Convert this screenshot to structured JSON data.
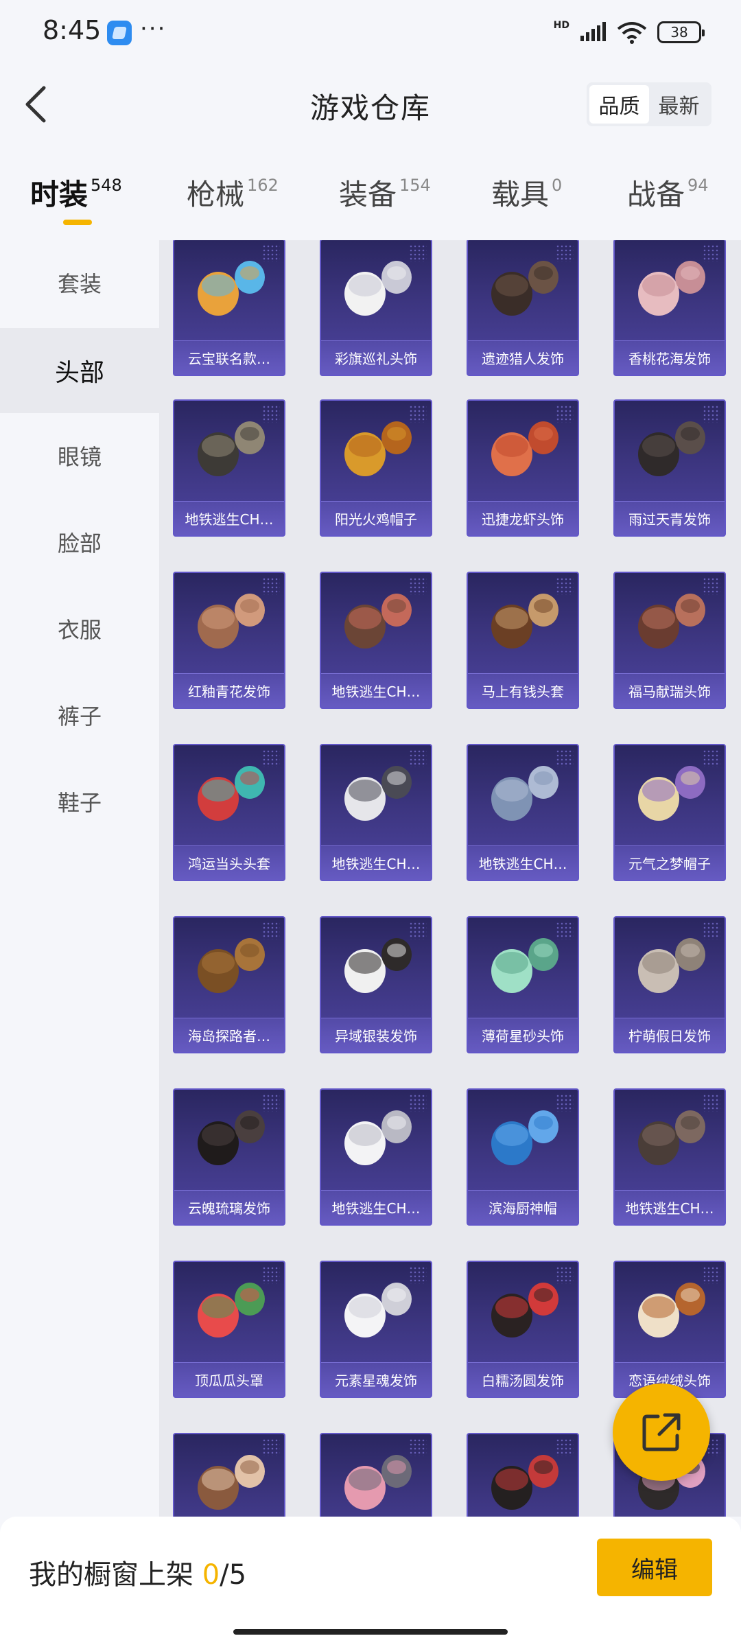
{
  "status_bar": {
    "time": "8:45",
    "more": "···",
    "network": "HD",
    "battery": "38",
    "wifi_sub": "6"
  },
  "header": {
    "title": "游戏仓库",
    "sort_options": [
      "品质",
      "最新"
    ],
    "active_sort": "品质"
  },
  "tabs": [
    {
      "label": "时装",
      "count": "548",
      "active": true
    },
    {
      "label": "枪械",
      "count": "162",
      "active": false
    },
    {
      "label": "装备",
      "count": "154",
      "active": false
    },
    {
      "label": "载具",
      "count": "0",
      "active": false
    },
    {
      "label": "战备",
      "count": "94",
      "active": false
    }
  ],
  "sidebar": {
    "items": [
      "套装",
      "头部",
      "眼镜",
      "脸部",
      "衣服",
      "裤子",
      "鞋子"
    ],
    "active": "头部"
  },
  "items": [
    "云宝联名款…",
    "彩旗巡礼头饰",
    "遗迹猎人发饰",
    "香桃花海发饰",
    "地铁逃生CH…",
    "阳光火鸡帽子",
    "迅捷龙虾头饰",
    "雨过天青发饰",
    "红釉青花发饰",
    "地铁逃生CH…",
    "马上有钱头套",
    "福马献瑞头饰",
    "鸿运当头头套",
    "地铁逃生CH…",
    "地铁逃生CH…",
    "元气之梦帽子",
    "海岛探路者…",
    "异域银装发饰",
    "薄荷星砂头饰",
    "柠萌假日发饰",
    "云魄琉璃发饰",
    "地铁逃生CH…",
    "滨海厨神帽",
    "地铁逃生CH…",
    "顶瓜瓜头罩",
    "元素星魂发饰",
    "白糯汤圆发饰",
    "恋语绒绒头饰",
    "",
    "",
    "",
    ""
  ],
  "bottom": {
    "prefix": "我的橱窗上架 ",
    "current": "0",
    "total": "/5",
    "edit_label": "编辑"
  },
  "colors": {
    "accent": "#f5b400",
    "card_bg": "#3c357f",
    "card_border": "#6257c8"
  }
}
